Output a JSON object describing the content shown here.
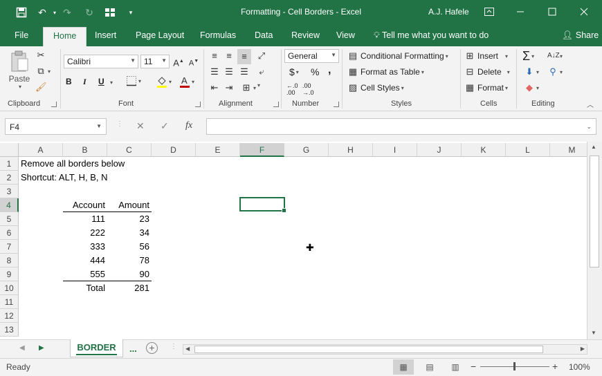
{
  "window": {
    "title": "Formatting - Cell Borders  -  Excel",
    "user": "A.J. Hafele",
    "accent": "#217346"
  },
  "tabs": [
    {
      "label": "File"
    },
    {
      "label": "Home",
      "active": true
    },
    {
      "label": "Insert"
    },
    {
      "label": "Page Layout"
    },
    {
      "label": "Formulas"
    },
    {
      "label": "Data"
    },
    {
      "label": "Review"
    },
    {
      "label": "View"
    }
  ],
  "tell_me": "Tell me what you want to do",
  "share": "Share",
  "ribbon": {
    "clipboard": {
      "label": "Clipboard",
      "paste": "Paste"
    },
    "font": {
      "label": "Font",
      "name": "Calibri",
      "size": "11",
      "bold": "B",
      "italic": "I",
      "underline": "U"
    },
    "alignment": {
      "label": "Alignment"
    },
    "number": {
      "label": "Number",
      "format": "General",
      "currency": "$",
      "percent": "%",
      "comma": ","
    },
    "styles": {
      "label": "Styles",
      "conditional": "Conditional Formatting",
      "format_table": "Format as Table",
      "cell_styles": "Cell Styles"
    },
    "cells": {
      "label": "Cells",
      "insert": "Insert",
      "delete": "Delete",
      "format": "Format"
    },
    "editing": {
      "label": "Editing"
    }
  },
  "formula_bar": {
    "name_box": "F4",
    "fx": "fx",
    "formula": ""
  },
  "grid": {
    "columns": [
      "A",
      "B",
      "C",
      "D",
      "E",
      "F",
      "G",
      "H",
      "I",
      "J",
      "K",
      "L",
      "M"
    ],
    "rows": [
      "1",
      "2",
      "3",
      "4",
      "5",
      "6",
      "7",
      "8",
      "9",
      "10",
      "11",
      "12",
      "13"
    ],
    "selected_col": "F",
    "selected_row": "4",
    "a1": "Remove all borders below",
    "a2": "Shortcut: ALT, H, B, N",
    "table": {
      "headers": [
        "Account",
        "Amount"
      ],
      "rows": [
        [
          "111",
          "23"
        ],
        [
          "222",
          "34"
        ],
        [
          "333",
          "56"
        ],
        [
          "444",
          "78"
        ],
        [
          "555",
          "90"
        ]
      ],
      "total_label": "Total",
      "total_value": "281"
    }
  },
  "sheets": {
    "active": "BORDER",
    "more": "..."
  },
  "status": {
    "ready": "Ready",
    "zoom": "100%"
  }
}
